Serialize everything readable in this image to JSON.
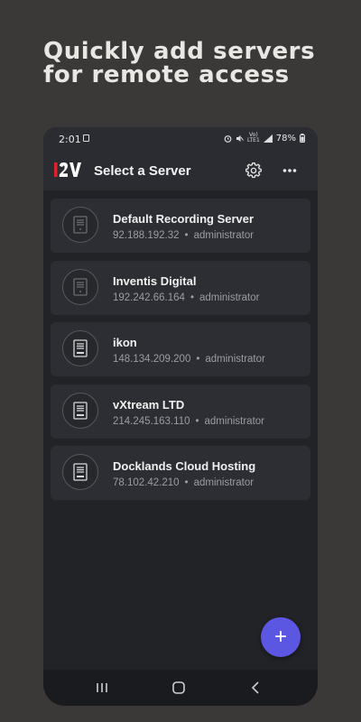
{
  "headline": "Quickly add servers for remote access",
  "status": {
    "time": "2:01",
    "battery": "78%",
    "icons": [
      "sim-card-icon",
      "alarm-icon",
      "mute-icon",
      "volte-icon",
      "signal-icon",
      "battery-icon"
    ],
    "volte_label": "Vo)) LTE1"
  },
  "appbar": {
    "logo_text": "I2V",
    "title": "Select a Server",
    "icons": [
      "gear-icon",
      "more-icon"
    ]
  },
  "servers": [
    {
      "name": "Default Recording Server",
      "ip": "92.188.192.32",
      "user": "administrator",
      "icon": "server-icon"
    },
    {
      "name": "Inventis Digital",
      "ip": "192.242.66.164",
      "user": "administrator",
      "icon": "server-icon"
    },
    {
      "name": "ikon",
      "ip": "148.134.209.200",
      "user": "administrator",
      "icon": "server-icon"
    },
    {
      "name": "vXtream LTD",
      "ip": "214.245.163.110",
      "user": "administrator",
      "icon": "server-icon"
    },
    {
      "name": "Docklands Cloud Hosting",
      "ip": "78.102.42.210",
      "user": "administrator",
      "icon": "server-icon"
    }
  ],
  "separator": "•",
  "fab_label": "+",
  "navbar": {
    "icons": [
      "recent-apps-icon",
      "home-icon",
      "back-icon"
    ]
  },
  "colors": {
    "accent": "#5b57e2",
    "background": "#222327",
    "card": "#2c2e33",
    "logo_red": "#d9232d"
  }
}
